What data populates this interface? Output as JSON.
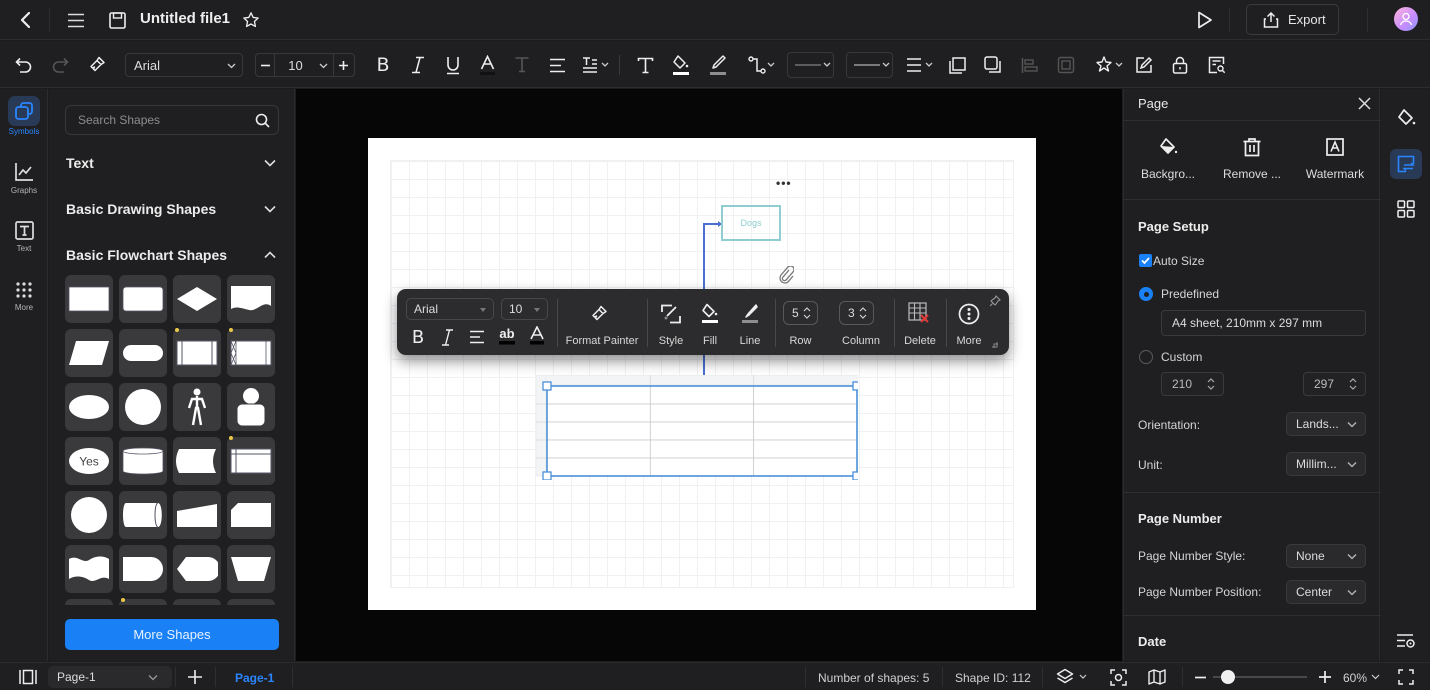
{
  "titlebar": {
    "file_title": "Untitled file1",
    "export_label": "Export"
  },
  "toolbar": {
    "font_family": "Arial",
    "font_size": "10"
  },
  "left_rail": {
    "items": [
      {
        "label": "Symbols",
        "icon": "symbols-icon",
        "active": true
      },
      {
        "label": "Graphs",
        "icon": "graph-icon",
        "active": false
      },
      {
        "label": "Text",
        "icon": "text-box-icon",
        "active": false
      },
      {
        "label": "More",
        "icon": "grid-dots-icon",
        "active": false
      }
    ]
  },
  "shapes_panel": {
    "search_placeholder": "Search Shapes",
    "categories": [
      {
        "label": "Text",
        "expanded": false
      },
      {
        "label": "Basic Drawing Shapes",
        "expanded": false
      },
      {
        "label": "Basic Flowchart Shapes",
        "expanded": true
      }
    ],
    "shape_tiles": [
      "process",
      "rounded-process",
      "decision",
      "document",
      "data",
      "terminator",
      "predefined-process",
      "stored-data-process",
      "ellipse",
      "circle",
      "actor",
      "user",
      "yes-decision",
      "database",
      "punched-tape",
      "internal-storage",
      "connector",
      "direct-access-storage",
      "manual-input",
      "card",
      "tape",
      "delay",
      "display",
      "manual-operation"
    ],
    "yes_tile_label": "Yes",
    "more_shapes_label": "More Shapes"
  },
  "canvas": {
    "dogs_label": "Dogs",
    "table": {
      "rows": 5,
      "columns": 3
    }
  },
  "floating_toolbar": {
    "font_family": "Arial",
    "font_size": "10",
    "format_painter_label": "Format Painter",
    "style_label": "Style",
    "fill_label": "Fill",
    "line_label": "Line",
    "row_value": "5",
    "row_label": "Row",
    "column_value": "3",
    "column_label": "Column",
    "delete_label": "Delete",
    "more_label": "More"
  },
  "right_panel": {
    "title": "Page",
    "actions": [
      {
        "label": "Backgro...",
        "icon": "fill-bucket-icon"
      },
      {
        "label": "Remove ...",
        "icon": "trash-icon"
      },
      {
        "label": "Watermark",
        "icon": "watermark-icon"
      }
    ],
    "page_setup": {
      "heading": "Page Setup",
      "auto_size_label": "Auto Size",
      "auto_size_checked": true,
      "predefined_label": "Predefined",
      "predefined_selected": true,
      "predefined_value": "A4 sheet, 210mm x 297 mm",
      "custom_label": "Custom",
      "custom_width": "210",
      "custom_height": "297",
      "orientation_label": "Orientation:",
      "orientation_value": "Lands...",
      "unit_label": "Unit:",
      "unit_value": "Millim..."
    },
    "page_number": {
      "heading": "Page Number",
      "style_label": "Page Number Style:",
      "style_value": "None",
      "position_label": "Page Number Position:",
      "position_value": "Center"
    },
    "date_heading": "Date"
  },
  "status_bar": {
    "page_select": "Page-1",
    "active_page_tab": "Page-1",
    "shape_count": "Number of shapes: 5",
    "shape_id": "Shape ID: 112",
    "zoom": "60%",
    "zoom_fraction": 0.08
  },
  "colors": {
    "accent": "#1a80f5",
    "selection": "#4a90d9",
    "connector": "#4a6fd0",
    "dogs_border": "#8fcdd1",
    "delete_x": "#e53935"
  }
}
